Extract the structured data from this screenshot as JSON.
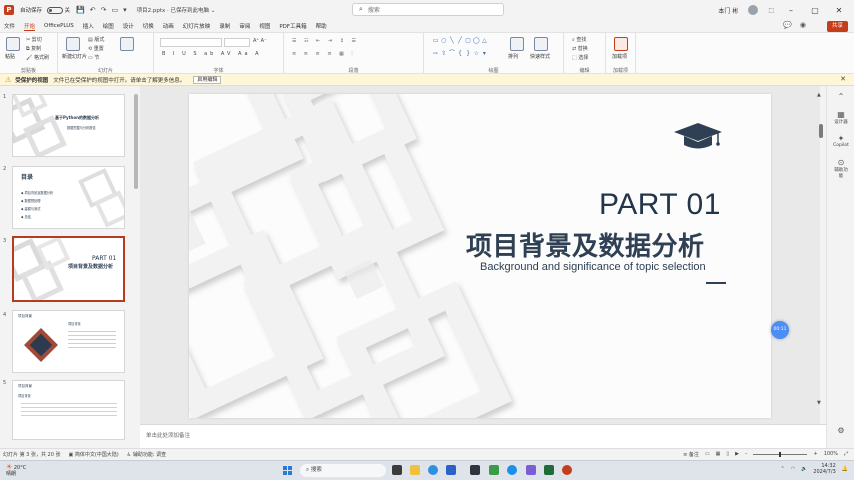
{
  "app": {
    "autosave_label": "自动保存",
    "autosave_state": "关",
    "doc_title": "项目2.pptx · 已保存到此电脑 ⌄",
    "search_placeholder": "搜索",
    "user_name": "本门 彬",
    "share_label": "共享"
  },
  "menu": [
    "文件",
    "开始",
    "OfficePLUS",
    "插入",
    "绘图",
    "设计",
    "切换",
    "动画",
    "幻灯片放映",
    "录制",
    "审阅",
    "视图",
    "PDF工具箱",
    "帮助"
  ],
  "ribbon": {
    "groups": [
      "剪贴板",
      "幻灯片",
      "字体",
      "段落",
      "绘图",
      "编辑",
      "加载项"
    ],
    "clipboard": {
      "paste": "粘贴",
      "cut": "剪切",
      "copy": "复制",
      "format_painter": "格式刷"
    },
    "slides": {
      "new_slide": "新建幻灯片",
      "layout": "版式",
      "reset": "重置",
      "section": "节"
    },
    "drawing": {
      "arrange": "排列",
      "quick_styles": "快速样式"
    },
    "editing": {
      "find": "查找",
      "replace": "替换",
      "select": "选择"
    },
    "addins": {
      "label": "加载项"
    }
  },
  "notice": {
    "title": "受保护的视图",
    "text": "文件已在受保护的视图中打开。请单击了解更多信息。",
    "button": "启用编辑"
  },
  "thumbnails": [
    {
      "num": "1",
      "title": "基于Python的数据分析",
      "subtitle": "数据挖掘与分析报告"
    },
    {
      "num": "2",
      "title": "目录",
      "items": [
        "项目背景及数据分析",
        "数据预处理",
        "建模与测试",
        "总结"
      ]
    },
    {
      "num": "3",
      "part": "PART 01",
      "title": "项目背景及数据分析"
    },
    {
      "num": "4",
      "title": "项目背景",
      "subtitle": "项目背景"
    },
    {
      "num": "5",
      "title": "项目背景",
      "subtitle": "项目背景"
    }
  ],
  "slide": {
    "part": "PART 01",
    "title": "项目背景及数据分析",
    "subtitle": "Background and significance of topic selection"
  },
  "badge": "00:11",
  "notes_placeholder": "单击此处添加备注",
  "status": {
    "slide_info": "幻灯片 第 3 张，共 20 张",
    "language": "简体中文(中国大陆)",
    "accessibility": "辅助功能: 调查",
    "notes": "备注",
    "zoom": "100%"
  },
  "taskbar": {
    "temp": "20°C",
    "weather": "晴朗",
    "search": "搜索",
    "time": "14:32",
    "date": "2024/7/3"
  },
  "right_panel": [
    "设计器",
    "Copilot",
    "辅助功能"
  ],
  "colors": {
    "accent": "#c43e1c",
    "slide_text": "#2f4054",
    "notice_bg": "#fdf6d8"
  }
}
